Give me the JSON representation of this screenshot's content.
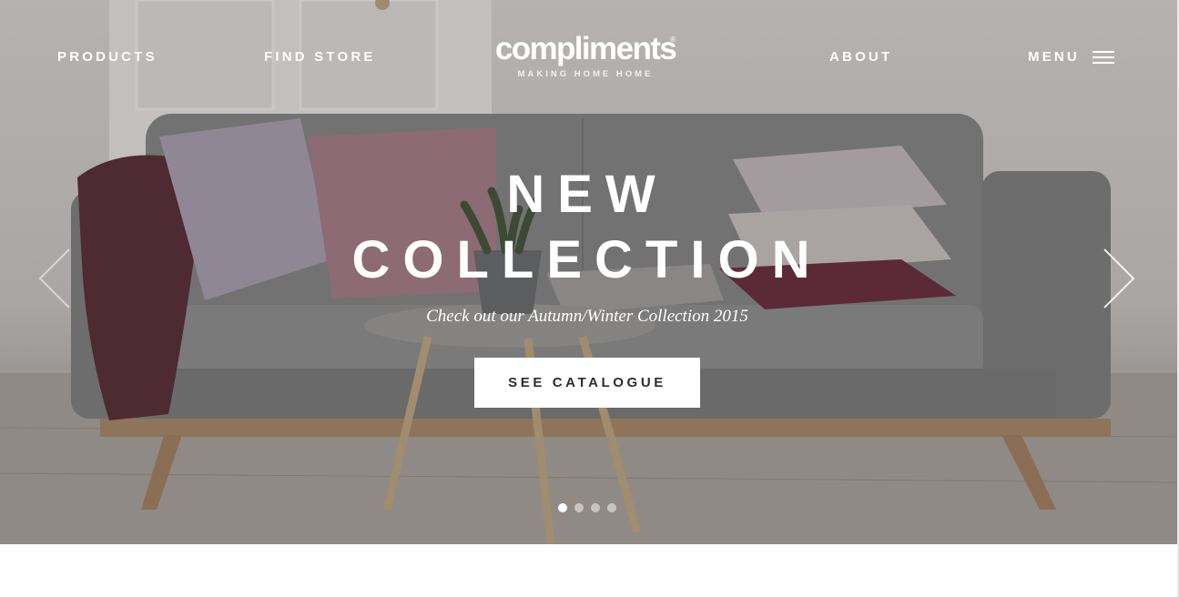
{
  "nav": {
    "products": "PRODUCTS",
    "find_store": "FIND STORE",
    "about": "ABOUT",
    "menu": "MENU"
  },
  "logo": {
    "wordmark": "compliments",
    "registered": "®",
    "tagline": "MAKING HOME HOME"
  },
  "hero": {
    "title_line1": "NEW",
    "title_line2": "COLLECTION",
    "subtitle": "Check out our Autumn/Winter Collection 2015",
    "cta_label": "SEE CATALOGUE"
  },
  "carousel": {
    "slide_count": 4,
    "active_slide": 1,
    "prev_icon": "chevron-left-icon",
    "next_icon": "chevron-right-icon"
  },
  "colors": {
    "text_light": "#ffffff",
    "button_text": "#2d2d2d",
    "plum": "#6e2a3e"
  }
}
